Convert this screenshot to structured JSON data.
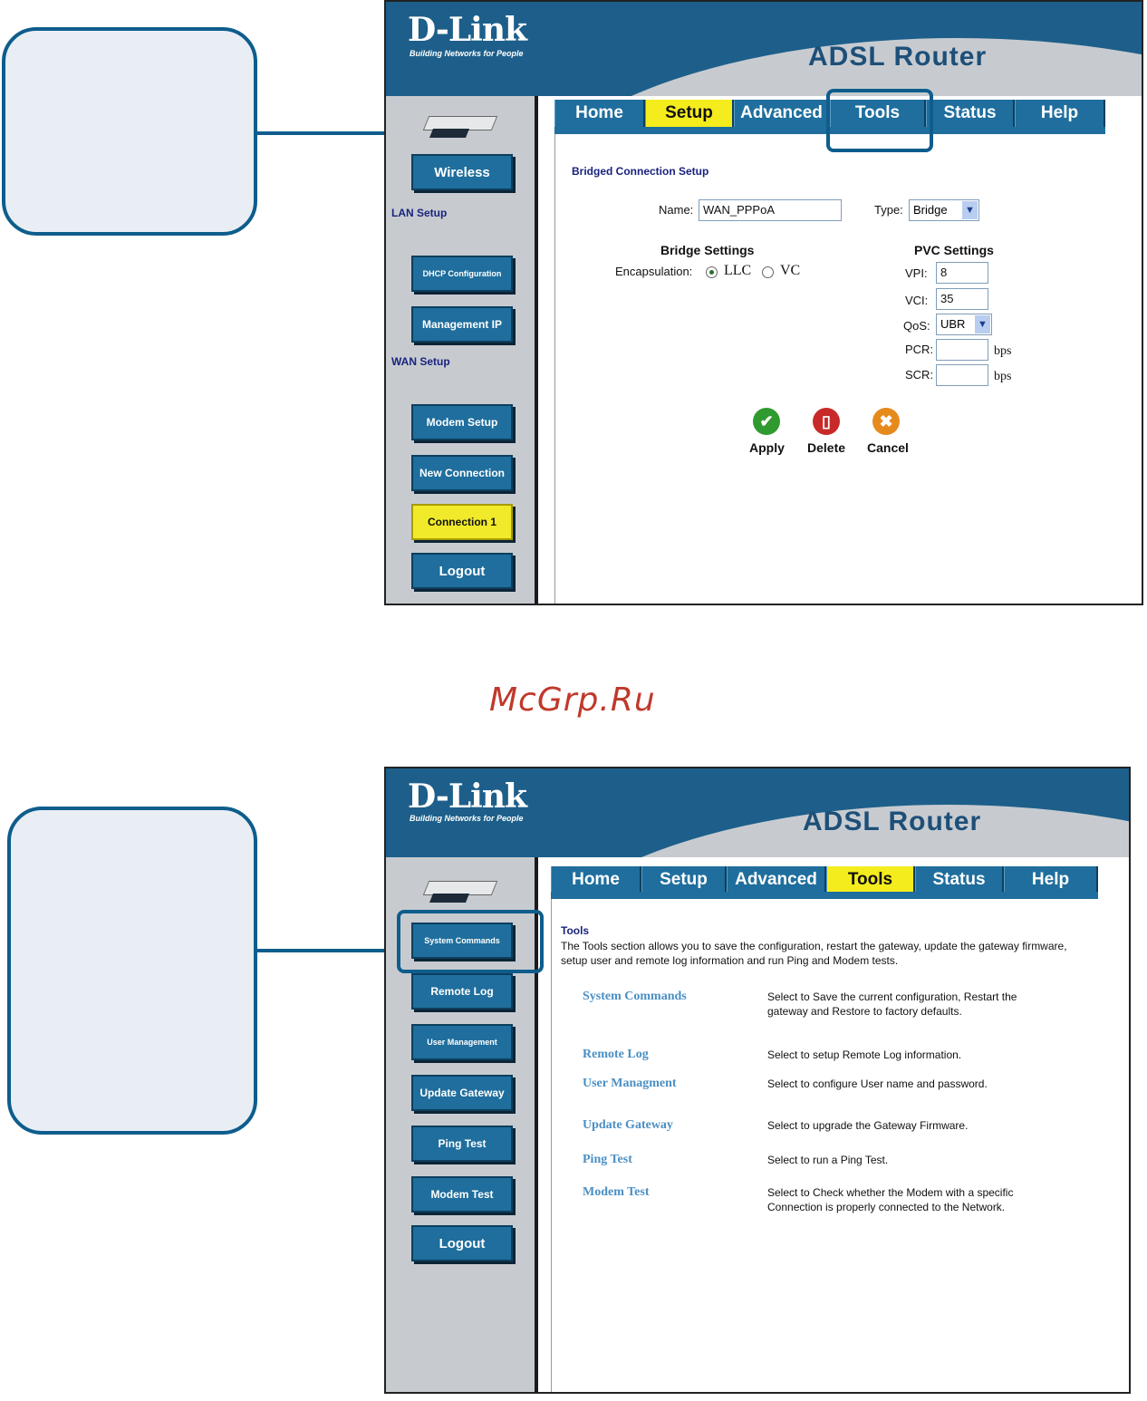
{
  "watermark": "McGrp.Ru",
  "colors": {
    "brand_blue": "#1d5f8a",
    "tab_blue": "#1f6e9d",
    "active_yellow": "#f5ec1e",
    "callout_border": "#0e5d8c"
  },
  "brand": {
    "logo": "D-Link",
    "tagline": "Building Networks for People",
    "product": "ADSL Router"
  },
  "tabs": [
    "Home",
    "Setup",
    "Advanced",
    "Tools",
    "Status",
    "Help"
  ],
  "shot1": {
    "active_tab": "Setup",
    "sidebar": {
      "wireless": "Wireless",
      "lan_label": "LAN Setup",
      "dhcp": "DHCP Configuration",
      "mgmt_ip": "Management IP",
      "wan_label": "WAN Setup",
      "modem_setup": "Modem Setup",
      "new_connection": "New Connection",
      "connection1": "Connection 1",
      "logout": "Logout"
    },
    "section_title": "Bridged Connection Setup",
    "name_label": "Name:",
    "name_value": "WAN_PPPoA",
    "type_label": "Type:",
    "type_value": "Bridge",
    "bridge_settings": "Bridge Settings",
    "encapsulation_label": "Encapsulation:",
    "llc": "LLC",
    "vc": "VC",
    "pvc_settings": "PVC Settings",
    "vpi_label": "VPI:",
    "vpi_value": "8",
    "vci_label": "VCI:",
    "vci_value": "35",
    "qos_label": "QoS:",
    "qos_value": "UBR",
    "pcr_label": "PCR:",
    "scr_label": "SCR:",
    "bps": "bps",
    "apply": "Apply",
    "delete": "Delete",
    "cancel": "Cancel"
  },
  "shot2": {
    "active_tab": "Tools",
    "sidebar": {
      "system_commands": "System Commands",
      "remote_log": "Remote Log",
      "user_management": "User Management",
      "update_gateway": "Update Gateway",
      "ping_test": "Ping Test",
      "modem_test": "Modem Test",
      "logout": "Logout"
    },
    "title": "Tools",
    "intro": "The Tools section allows you to save the configuration, restart the gateway, update the gateway firmware, setup user and remote log information and run Ping and Modem tests.",
    "items": [
      {
        "link": "System Commands",
        "desc": "Select to Save the current configuration, Restart the gateway and Restore to factory defaults."
      },
      {
        "link": "Remote Log",
        "desc": "Select to setup Remote Log information."
      },
      {
        "link": "User Managment",
        "desc": "Select to configure User name and password."
      },
      {
        "link": "Update Gateway",
        "desc": "Select to upgrade the Gateway Firmware."
      },
      {
        "link": "Ping Test",
        "desc": "Select to run a Ping Test."
      },
      {
        "link": "Modem Test",
        "desc": "Select to Check whether the Modem with a specific Connection is properly connected to the Network."
      }
    ]
  }
}
